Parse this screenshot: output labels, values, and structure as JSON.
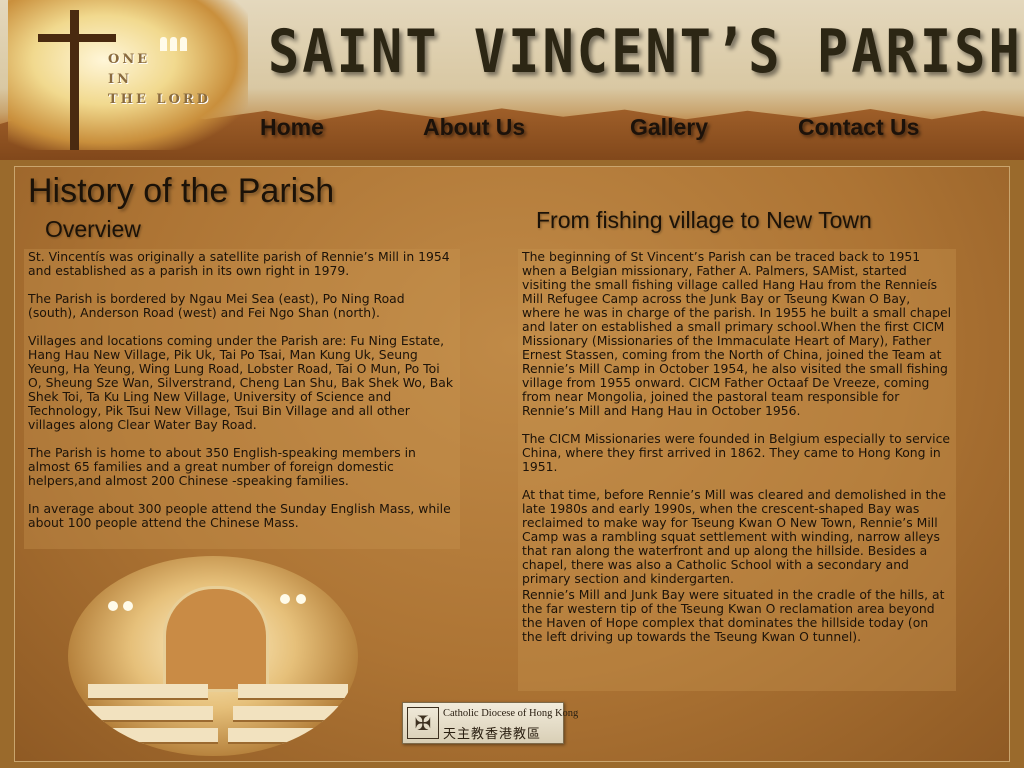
{
  "header": {
    "site_title": "SAINT VINCENT’S PARISH",
    "emblem_text": [
      "ONE",
      "IN",
      "THE LORD"
    ]
  },
  "nav": {
    "items": [
      "Home",
      "About Us",
      "Gallery",
      "Contact Us"
    ]
  },
  "main": {
    "page_title": "History of the Parish",
    "left": {
      "subtitle": "Overview",
      "paragraphs": [
        "St. Vincentís was originally a satellite parish of Rennie’s Mill in 1954 and established as a parish in its own right in 1979.",
        "The Parish is bordered by Ngau Mei Sea (east), Po Ning Road (south), Anderson Road (west) and Fei Ngo Shan (north).",
        "Villages and locations coming under the Parish are: Fu Ning Estate, Hang Hau New Village, Pik Uk, Tai Po Tsai, Man Kung Uk, Seung Yeung, Ha Yeung, Wing Lung Road, Lobster Road, Tai O Mun, Po Toi O, Sheung Sze Wan, Silverstrand, Cheng Lan Shu, Bak Shek Wo, Bak Shek Toi, Ta Ku Ling New Village, University of Science and Technology, Pik Tsui New Village, Tsui Bin Village and all other villages along Clear Water Bay Road.",
        "The Parish is home to about 350 English-speaking members in almost 65 families and a great number of foreign domestic helpers,and almost 200 Chinese -speaking families.",
        "In average about 300 people attend the Sunday English Mass, while about 100 people attend the Chinese Mass."
      ]
    },
    "right": {
      "subtitle": "From fishing village to New Town",
      "paragraphs": [
        "The beginning of St Vincent’s Parish can be traced back to 1951 when a Belgian missionary, Father A. Palmers, SAMist, started visiting the small fishing village called Hang Hau from the Rennieís Mill Refugee Camp across the Junk Bay or Tseung Kwan O Bay, where he was in charge of the parish. In 1955 he built a small chapel and later on established a small primary school.When the first CICM Missionary (Missionaries of the Immaculate Heart of Mary), Father Ernest Stassen, coming from the North of China, joined the Team at Rennie’s Mill Camp in October 1954, he also visited the small fishing village from 1955 onward. CICM Father Octaaf De Vreeze, coming from near Mongolia, joined the pastoral team responsible for Rennie’s Mill and Hang Hau in October 1956.",
        "The CICM Missionaries were founded in Belgium especially to service China, where they first arrived in 1862. They came to Hong Kong in 1951.",
        "At that time, before Rennie’s Mill was cleared and demolished in the late 1980s and early 1990s, when the crescent-shaped Bay was reclaimed to make way for Tseung Kwan O New Town, Rennie’s Mill Camp was a rambling squat settlement with winding, narrow alleys that ran along the waterfront and up along the hillside. Besides a chapel, there was also a Catholic School with a secondary and primary section and kindergarten.",
        "Rennie’s Mill and Junk Bay were situated in the cradle of the hills, at the far western tip of the Tseung Kwan O reclamation area beyond the Haven of Hope complex that dominates the hillside today (on the left driving up towards the Tseung Kwan O tunnel)."
      ]
    }
  },
  "footer": {
    "diocese_en": "Catholic Diocese of Hong Kong",
    "diocese_zh": "天主教香港教區"
  },
  "colors": {
    "background": "#9a6a2c",
    "panel": "#b57c3a",
    "text": "#1d1309"
  }
}
